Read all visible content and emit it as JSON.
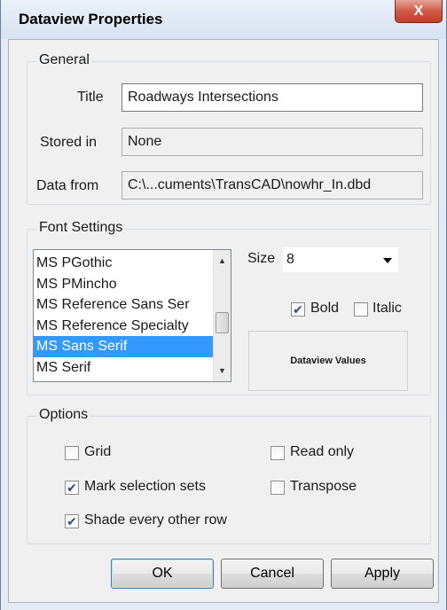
{
  "window": {
    "title": "Dataview Properties",
    "close_label": "X"
  },
  "general": {
    "label": "General",
    "title_label": "Title",
    "title_value": "Roadways Intersections",
    "stored_label": "Stored in",
    "stored_value": "None",
    "data_from_label": "Data from",
    "data_from_value": "C:\\...cuments\\TransCAD\\nowhr_In.dbd"
  },
  "font": {
    "label": "Font Settings",
    "fonts": [
      {
        "name": "MS PGothic",
        "selected": false
      },
      {
        "name": "MS PMincho",
        "selected": false
      },
      {
        "name": "MS Reference Sans Ser",
        "selected": false
      },
      {
        "name": "MS Reference Specialty",
        "selected": false
      },
      {
        "name": "MS Sans Serif",
        "selected": true
      },
      {
        "name": "MS Serif",
        "selected": false
      }
    ],
    "size_label": "Size",
    "size_value": "8",
    "bold_label": "Bold",
    "bold_checked": true,
    "italic_label": "Italic",
    "italic_checked": false,
    "preview_text": "Dataview Values"
  },
  "options": {
    "label": "Options",
    "grid_label": "Grid",
    "grid_checked": false,
    "read_only_label": "Read only",
    "read_only_checked": false,
    "mark_label": "Mark selection sets",
    "mark_checked": true,
    "transpose_label": "Transpose",
    "transpose_checked": false,
    "shade_label": "Shade every other row",
    "shade_checked": true
  },
  "buttons": {
    "ok": "OK",
    "cancel": "Cancel",
    "apply": "Apply"
  }
}
